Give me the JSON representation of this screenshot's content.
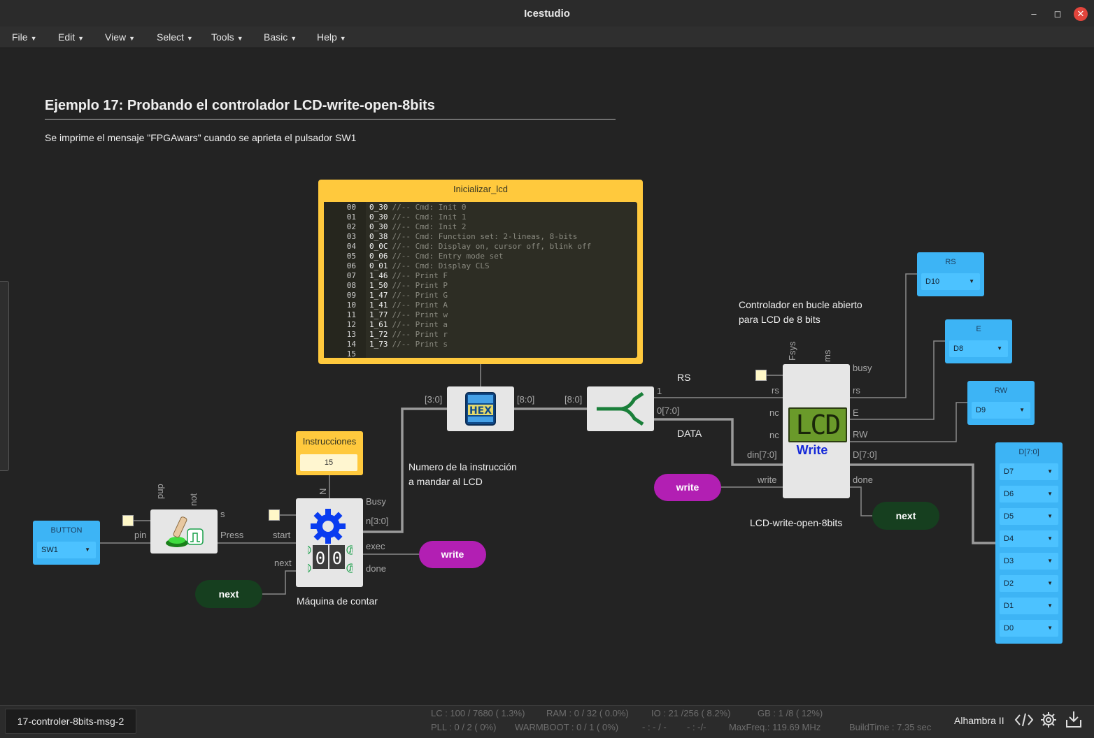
{
  "window": {
    "title": "Icestudio"
  },
  "menu": [
    "File",
    "Edit",
    "View",
    "Select",
    "Tools",
    "Basic",
    "Help"
  ],
  "design": {
    "title": "Ejemplo 17: Probando el controlador LCD-write-open-8bits",
    "subtitle": "Se imprime el mensaje \"FPGAwars\" cuando se aprieta el pulsador SW1",
    "note_counter": [
      "Numero de la instrucción",
      "a mandar al LCD"
    ],
    "note_controller": [
      "Controlador en bucle abierto",
      "para LCD de 8 bits"
    ]
  },
  "memory": {
    "title": "Inicializar_lcd",
    "lines": [
      {
        "n": "00",
        "v": "0_30",
        "c": "//-- Cmd: Init 0"
      },
      {
        "n": "01",
        "v": "0_30",
        "c": "//-- Cmd: Init 1"
      },
      {
        "n": "02",
        "v": "0_30",
        "c": "//-- Cmd: Init 2"
      },
      {
        "n": "03",
        "v": "0_38",
        "c": "//-- Cmd: Function set: 2-lineas, 8-bits"
      },
      {
        "n": "04",
        "v": "0_0C",
        "c": "//-- Cmd: Display on, cursor off, blink off"
      },
      {
        "n": "05",
        "v": "0_06",
        "c": "//-- Cmd: Entry mode set"
      },
      {
        "n": "06",
        "v": "0_01",
        "c": "//-- Cmd: Display CLS"
      },
      {
        "n": "07",
        "v": "1_46",
        "c": "//-- Print F"
      },
      {
        "n": "08",
        "v": "1_50",
        "c": "//-- Print P"
      },
      {
        "n": "09",
        "v": "1_47",
        "c": "//-- Print G"
      },
      {
        "n": "10",
        "v": "1_41",
        "c": "//-- Print A"
      },
      {
        "n": "11",
        "v": "1_77",
        "c": "//-- Print w"
      },
      {
        "n": "12",
        "v": "1_61",
        "c": "//-- Print a"
      },
      {
        "n": "13",
        "v": "1_72",
        "c": "//-- Print r"
      },
      {
        "n": "14",
        "v": "1_73",
        "c": "//-- Print s"
      },
      {
        "n": "15",
        "v": "",
        "c": ""
      }
    ]
  },
  "constant": {
    "title": "Instrucciones",
    "value": "15"
  },
  "button_input": {
    "title": "BUTTON",
    "pin": "SW1"
  },
  "outputs": {
    "rs": {
      "title": "RS",
      "pin": "D10"
    },
    "e": {
      "title": "E",
      "pin": "D8"
    },
    "rw": {
      "title": "RW",
      "pin": "D9"
    },
    "data": {
      "title": "D[7:0]",
      "pins": [
        "D7",
        "D6",
        "D5",
        "D4",
        "D3",
        "D2",
        "D1",
        "D0"
      ]
    }
  },
  "ports": {
    "button_pup": "pup",
    "button_not": "not",
    "button_pin": "pin",
    "button_s": "s",
    "button_press": "Press",
    "counter_n": "N",
    "counter_start": "start",
    "counter_next": "next",
    "counter_busy": "Busy",
    "counter_ncount": "n[3:0]",
    "counter_exec": "exec",
    "counter_done": "done",
    "hex_in": "[3:0]",
    "hex_out": "[8:0]",
    "split_in": "[8:0]",
    "split_1": "1",
    "split_bus": "0[7:0]",
    "lcd_fsys": "Fsys",
    "lcd_ms": "ms",
    "lcd_rs_in": "rs",
    "lcd_nc1": "nc",
    "lcd_nc2": "nc",
    "lcd_din": "din[7:0]",
    "lcd_write": "write",
    "lcd_busy": "busy",
    "lcd_rs_out": "rs",
    "lcd_e": "E",
    "lcd_rw": "RW",
    "lcd_d": "D[7:0]",
    "lcd_done": "done"
  },
  "wire_labels": {
    "rs": "RS",
    "data": "DATA"
  },
  "blocks": {
    "counter_label": "Máquina de contar",
    "lcd_label": "LCD-write-open-8bits",
    "lcd_screen": "LCD",
    "lcd_write": "Write",
    "hex_text": "HEX",
    "counter_digits": [
      "0",
      "0"
    ]
  },
  "labels": {
    "write_exec": "write",
    "next_done": "next",
    "next_in": "next",
    "write_in": "write"
  },
  "status": {
    "project": "17-controler-8bits-msg-2",
    "lc": "LC : 100 / 7680 ( 1.3%)",
    "ram": "RAM : 0 / 32 ( 0.0%)",
    "io": "IO :  21 /256  ( 8.2%)",
    "gb": "GB :  1 /8  ( 12%)",
    "pll": "PLL : 0 / 2 ( 0%)",
    "warmboot": "WARMBOOT : 0 / 1 ( 0%)",
    "dash1": "- : - / -",
    "dash2": "- : -/-",
    "maxfreq": "MaxFreq.:  119.69 MHz",
    "buildtime": "BuildTime :  7.35 sec",
    "board": "Alhambra II"
  },
  "icons": [
    "code-icon",
    "gear-icon",
    "download-icon",
    "minimize-icon",
    "maximize-icon",
    "close-icon"
  ]
}
